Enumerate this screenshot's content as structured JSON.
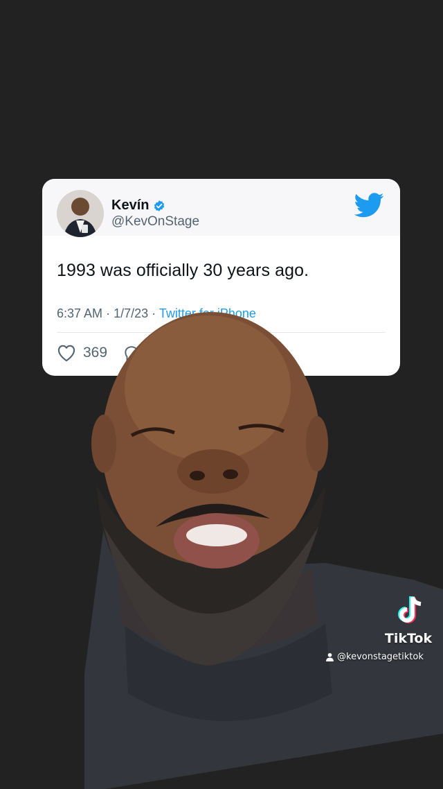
{
  "tweet": {
    "display_name": "Kevín",
    "handle": "@KevOnStage",
    "text": "1993 was officially 30 years ago.",
    "time": "6:37 AM",
    "date": "1/7/23",
    "separator": "·",
    "source": "Twitter for iPhone",
    "likes": "369",
    "avatar_icon": "profile-photo",
    "verified_icon": "verified-badge-icon",
    "platform_icon": "twitter-bird-icon"
  },
  "watermark": {
    "brand": "TikTok",
    "user": "@kevonstagetiktok",
    "logo_icon": "tiktok-note-icon",
    "user_icon": "person-icon"
  },
  "colors": {
    "background": "#232222",
    "card": "#ffffff",
    "accent": "#1d9bf0",
    "text_primary": "#0f1419",
    "text_secondary": "#536471"
  }
}
